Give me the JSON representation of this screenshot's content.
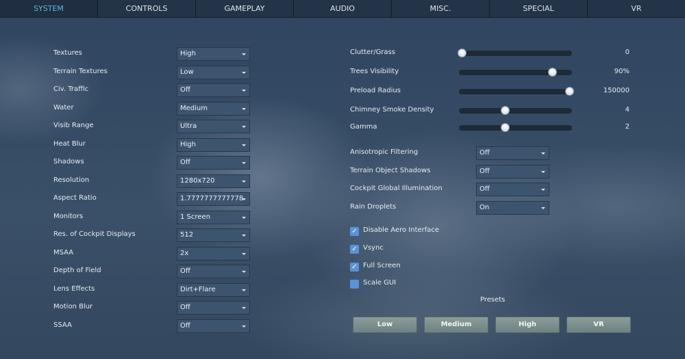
{
  "tabs": [
    "SYSTEM",
    "CONTROLS",
    "GAMEPLAY",
    "AUDIO",
    "MISC.",
    "SPECIAL",
    "VR"
  ],
  "active_tab": "SYSTEM",
  "left_options": [
    {
      "label": "Textures",
      "value": "High"
    },
    {
      "label": "Terrain Textures",
      "value": "Low"
    },
    {
      "label": "Civ. Traffic",
      "value": "Off"
    },
    {
      "label": "Water",
      "value": "Medium"
    },
    {
      "label": "Visib Range",
      "value": "Ultra"
    },
    {
      "label": "Heat Blur",
      "value": "High"
    },
    {
      "label": "Shadows",
      "value": "Off"
    },
    {
      "label": "Resolution",
      "value": "1280x720"
    },
    {
      "label": "Aspect Ratio",
      "value": "1.7777777777778"
    },
    {
      "label": "Monitors",
      "value": "1 Screen"
    },
    {
      "label": "Res. of Cockpit Displays",
      "value": "512"
    },
    {
      "label": "MSAA",
      "value": "2x"
    },
    {
      "label": "Depth of Field",
      "value": "Off"
    },
    {
      "label": "Lens Effects",
      "value": "Dirt+Flare"
    },
    {
      "label": "Motion Blur",
      "value": "Off"
    },
    {
      "label": "SSAA",
      "value": "Off"
    }
  ],
  "sliders": [
    {
      "label": "Clutter/Grass",
      "value": "0",
      "fraction": 0
    },
    {
      "label": "Trees Visibility",
      "value": "90%",
      "fraction": 0.84
    },
    {
      "label": "Preload Radius",
      "value": "150000",
      "fraction": 1
    },
    {
      "label": "Chimney Smoke Density",
      "value": "4",
      "fraction": 0.4
    },
    {
      "label": "Gamma",
      "value": "2",
      "fraction": 0.4
    }
  ],
  "right_options": [
    {
      "label": "Anisotropic Filtering",
      "value": "Off"
    },
    {
      "label": "Terrain Object Shadows",
      "value": "Off"
    },
    {
      "label": "Cockpit Global Illumination",
      "value": "Off"
    },
    {
      "label": "Rain Droplets",
      "value": "On"
    }
  ],
  "checkboxes": [
    {
      "label": "Disable Aero Interface",
      "checked": true
    },
    {
      "label": "Vsync",
      "checked": true
    },
    {
      "label": "Full Screen",
      "checked": true
    },
    {
      "label": "Scale GUI",
      "checked": false
    }
  ],
  "presets": {
    "title": "Presets",
    "buttons": [
      "Low",
      "Medium",
      "High",
      "VR"
    ]
  }
}
